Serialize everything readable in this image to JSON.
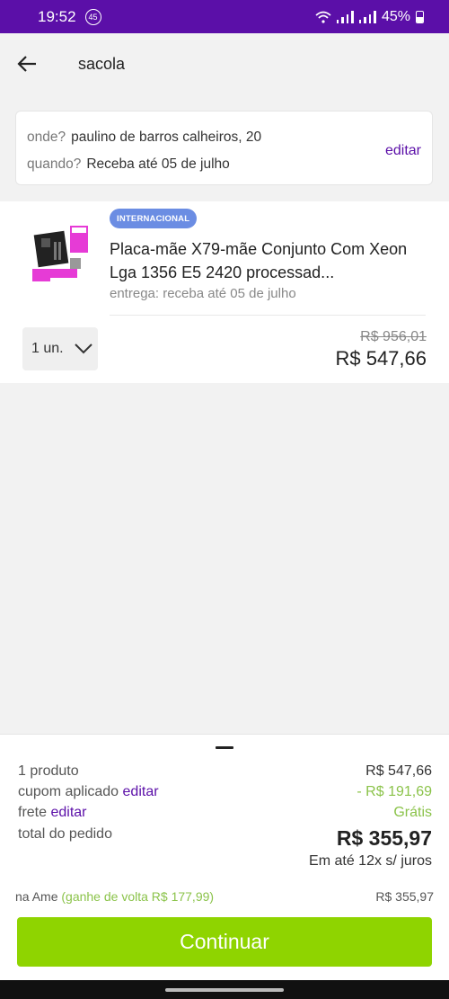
{
  "status_bar": {
    "time": "19:52",
    "notification_count": "45",
    "battery": "45%",
    "battery_level": 0.45
  },
  "app_bar": {
    "back_icon": "arrow-left-icon",
    "title": "sacola"
  },
  "address": {
    "where_label": "onde?",
    "where_value": "paulino de barros calheiros, 20",
    "when_label": "quando?",
    "when_value": "Receba até 05 de julho",
    "edit_label": "editar"
  },
  "product": {
    "badge": "INTERNACIONAL",
    "title": "Placa-mãe X79-mãe Conjunto Com Xeon Lga 1356 E5 2420 processad...",
    "delivery": "entrega: receba até 05 de julho",
    "quantity": "1 un.",
    "old_price": "R$ 956,01",
    "price": "R$ 547,66",
    "image_icon": "motherboard-product-image"
  },
  "summary": {
    "products_label": "1 produto",
    "products_value": "R$ 547,66",
    "coupon_label": "cupom aplicado",
    "coupon_edit": "editar",
    "coupon_value": "- R$ 191,69",
    "shipping_label": "frete",
    "shipping_edit": "editar",
    "shipping_value": "Grátis",
    "total_label": "total do pedido",
    "total_value": "R$ 355,97",
    "installments": "Em até 12x s/ juros",
    "ame_label": "na Ame",
    "ame_cashback": "(ganhe de volta R$ 177,99)",
    "ame_value": "R$ 355,97",
    "continue_label": "Continuar"
  },
  "colors": {
    "brand_purple": "#5b0fa8",
    "cta_green": "#8fd400",
    "discount_green": "#8bc34a",
    "badge_blue": "#6b8de3"
  }
}
